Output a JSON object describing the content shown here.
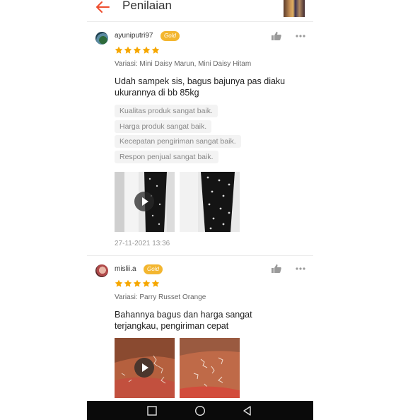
{
  "header": {
    "title": "Penilaian",
    "back_icon": "arrow-left-icon",
    "accent_color": "#ee4d2d"
  },
  "reviews": [
    {
      "username": "ayuniputri97",
      "badge": "Gold",
      "rating": 5,
      "variation": "Variasi: Mini Daisy Marun, Mini Daisy Hitam",
      "comment": "Udah sampek sis, bagus bajunya pas diaku ukurannya di bb 85kg",
      "tags": [
        "Kualitas produk sangat baik.",
        "Harga produk sangat baik.",
        "Kecepatan pengiriman sangat baik.",
        "Respon penjual sangat baik."
      ],
      "media": [
        {
          "kind": "video",
          "icon": "play-icon"
        },
        {
          "kind": "photo"
        }
      ],
      "date": "27-11-2021 13:36"
    },
    {
      "username": "mislii.a",
      "badge": "Gold",
      "rating": 5,
      "variation": "Variasi: Parry Russet Orange",
      "comment": "Bahannya bagus dan harga sangat terjangkau, pengiriman cepat",
      "media": [
        {
          "kind": "video",
          "icon": "play-icon"
        },
        {
          "kind": "photo"
        }
      ]
    }
  ],
  "colors": {
    "badge": "#f3b630",
    "star": "#f6a700"
  },
  "navbar": {
    "icons": [
      "recent-apps-icon",
      "home-icon",
      "back-icon"
    ]
  }
}
